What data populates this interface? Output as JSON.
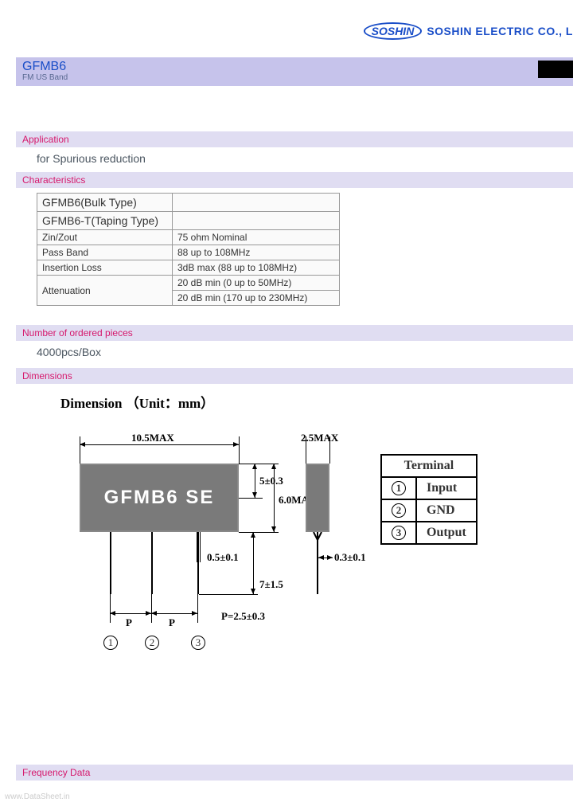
{
  "header": {
    "logo_text": "SOSHIN",
    "company_name": "SOSHIN  ELECTRIC  CO., L"
  },
  "title": {
    "main": "GFMB6",
    "sub": "FM US Band"
  },
  "sections": {
    "application": {
      "heading": "Application",
      "text": "for Spurious reduction"
    },
    "characteristics": {
      "heading": "Characteristics",
      "rows": [
        {
          "c1": "GFMB6(Bulk Type)",
          "c2": ""
        },
        {
          "c1": "GFMB6-T(Taping Type)",
          "c2": ""
        },
        {
          "c1": "Zin/Zout",
          "c2": "75 ohm Nominal"
        },
        {
          "c1": "Pass Band",
          "c2": "88 up to 108MHz"
        },
        {
          "c1": "Insertion Loss",
          "c2": "3dB max (88 up to 108MHz)"
        },
        {
          "c1_rowspan": "Attenuation",
          "c2": "20 dB min (0 up to 50MHz)"
        },
        {
          "c2": "20 dB min (170 up to 230MHz)"
        }
      ]
    },
    "pieces": {
      "heading": "Number of ordered pieces",
      "text": "4000pcs/Box"
    },
    "dimensions": {
      "heading": "Dimensions",
      "label": "Dimension （Unit：mm）"
    },
    "frequency": {
      "heading": "Frequency Data"
    }
  },
  "diagram": {
    "component_marking": "GFMB6 SE",
    "dims": {
      "width_top": "10.5MAX",
      "height_right_5": "5±0.3",
      "height_right_6": "6.0MAX",
      "lead_width": "0.5±0.1",
      "lead_length": "7±1.5",
      "pitch_P": "P",
      "pitch_val": "P=2.5±0.3",
      "side_width": "2.5MAX",
      "lead_thick": "0.3±0.1"
    },
    "terminals": {
      "header": "Terminal",
      "rows": [
        {
          "num": "1",
          "label": "Input"
        },
        {
          "num": "2",
          "label": "GND"
        },
        {
          "num": "3",
          "label": "Output"
        }
      ]
    },
    "bottom_nums": [
      "1",
      "2",
      "3"
    ]
  },
  "watermark": "www.DataSheet.in"
}
